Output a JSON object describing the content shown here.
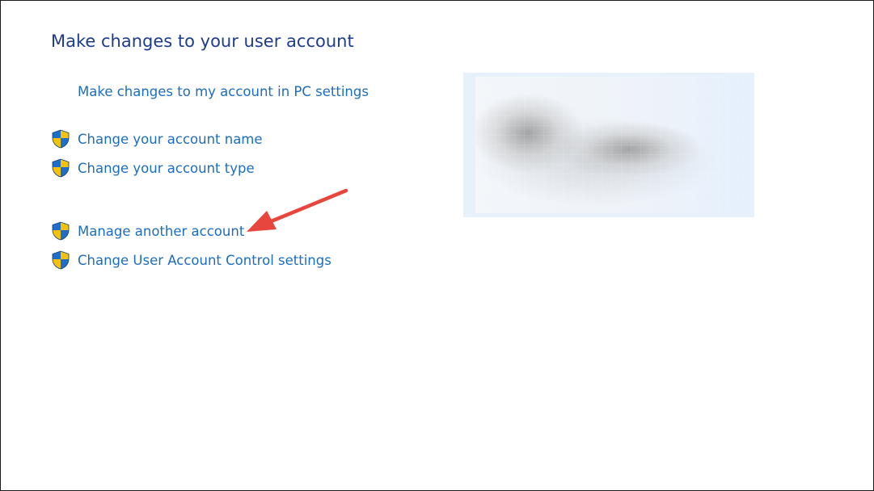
{
  "page": {
    "title": "Make changes to your user account"
  },
  "links": {
    "pc_settings": "Make changes to my account in PC settings"
  },
  "tasks": [
    {
      "label": "Change your account name",
      "icon": "uac-shield-icon"
    },
    {
      "label": "Change your account type",
      "icon": "uac-shield-icon"
    },
    {
      "label": "Manage another account",
      "icon": "uac-shield-icon"
    },
    {
      "label": "Change User Account Control settings",
      "icon": "uac-shield-icon"
    }
  ],
  "colors": {
    "title": "#1e3c8c",
    "link": "#1d6dbe",
    "tile_bg": "#e6f1fc",
    "annotation_arrow": "#e8453c",
    "shield_blue": "#1f6fc9",
    "shield_yellow": "#f4c20d"
  },
  "annotation": {
    "type": "arrow",
    "points_to": "Manage another account"
  }
}
